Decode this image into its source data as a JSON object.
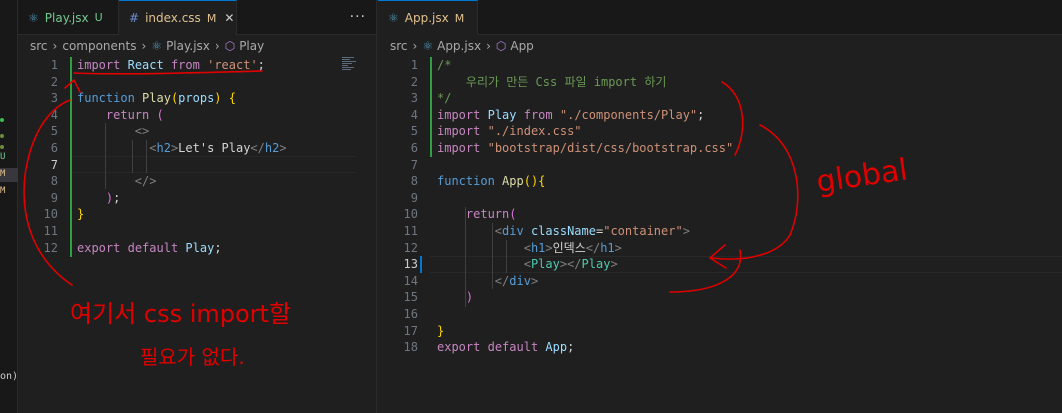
{
  "activity": {
    "markers": [
      "U",
      "M",
      "M"
    ],
    "bottom_text": "on)"
  },
  "left": {
    "tabs": [
      {
        "icon": "⚛",
        "name": "Play.jsx",
        "status": "U"
      },
      {
        "icon": "#",
        "name": "index.css",
        "status": "M"
      }
    ],
    "more": "···",
    "breadcrumb": [
      "src",
      "components",
      "Play.jsx",
      "Play"
    ],
    "lines": [
      "1",
      "2",
      "3",
      "4",
      "5",
      "6",
      "7",
      "8",
      "9",
      "10",
      "11",
      "12"
    ],
    "active_line": "7"
  },
  "right": {
    "tabs": [
      {
        "icon": "⚛",
        "name": "App.jsx",
        "status": "M"
      }
    ],
    "breadcrumb": [
      "src",
      "App.jsx",
      "App"
    ],
    "lines": [
      "1",
      "2",
      "3",
      "4",
      "5",
      "6",
      "7",
      "8",
      "9",
      "10",
      "11",
      "12",
      "13",
      "14",
      "15",
      "16",
      "17",
      "18"
    ],
    "active_line": "13"
  },
  "annotations": {
    "global": "global",
    "note_line1": "여기서 css import할",
    "note_line2": "필요가 없다."
  },
  "colors": {
    "ink": "#e00000",
    "accent": "#0078d4",
    "untracked": "#73c991",
    "modified": "#e2c08d"
  }
}
